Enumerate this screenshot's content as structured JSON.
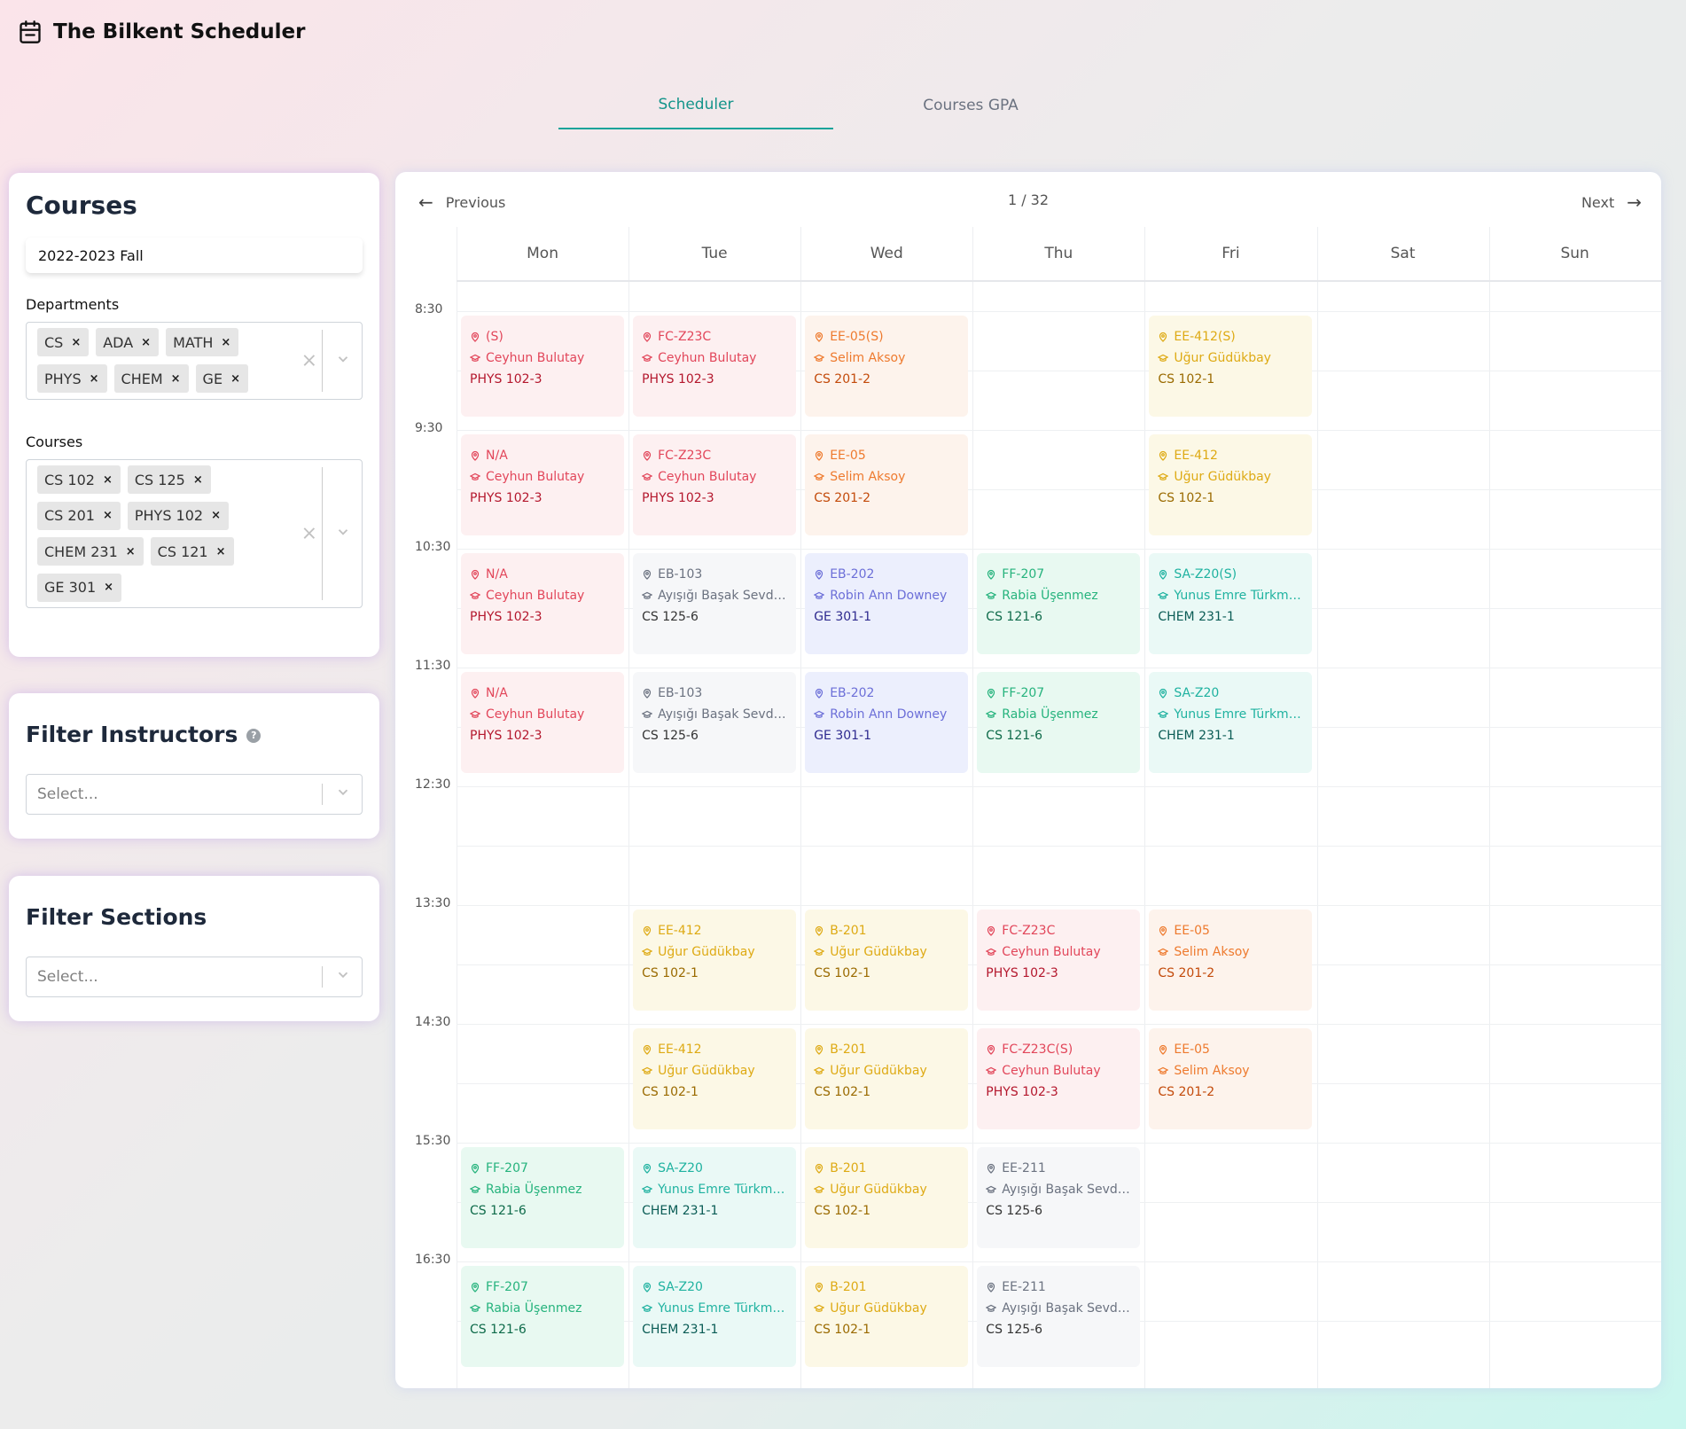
{
  "app": {
    "title": "The Bilkent Scheduler",
    "logo_icon": "calendar-icon"
  },
  "tabs": [
    {
      "label": "Scheduler",
      "active": true
    },
    {
      "label": "Courses GPA",
      "active": false
    }
  ],
  "sidebar": {
    "courses_card": {
      "title": "Courses",
      "semester": "2022-2023 Fall",
      "departments_label": "Departments",
      "departments": [
        "CS",
        "ADA",
        "MATH",
        "PHYS",
        "CHEM",
        "GE"
      ],
      "courses_label": "Courses",
      "courses": [
        "CS 102",
        "CS 125",
        "CS 201",
        "PHYS 102",
        "CHEM 231",
        "CS 121",
        "GE 301"
      ],
      "remove_glyph": "×",
      "clear_glyph": "×"
    },
    "instructors_card": {
      "title": "Filter Instructors",
      "help": "?",
      "placeholder": "Select..."
    },
    "sections_card": {
      "title": "Filter Sections",
      "placeholder": "Select..."
    }
  },
  "calendar": {
    "prev_label": "Previous",
    "next_label": "Next",
    "page": "1 / 32",
    "days": [
      "Mon",
      "Tue",
      "Wed",
      "Thu",
      "Fri",
      "Sat",
      "Sun"
    ],
    "times": [
      "8:30",
      "9:30",
      "10:30",
      "11:30",
      "12:30",
      "13:30",
      "14:30",
      "15:30",
      "16:30"
    ],
    "colors": {
      "red": "#e2465a",
      "orange": "#ee7a2e",
      "yellow": "#deaa14",
      "gray": "#6b7280",
      "indigo": "#6c6fd8",
      "green": "#26b37d",
      "teal": "#1fb2a0"
    },
    "events": [
      {
        "day": 0,
        "slot": 0,
        "color": "red",
        "room": "(S)",
        "instructor": "Ceyhun Bulutay",
        "course": "PHYS 102-3"
      },
      {
        "day": 0,
        "slot": 1,
        "color": "red",
        "room": "N/A",
        "instructor": "Ceyhun Bulutay",
        "course": "PHYS 102-3"
      },
      {
        "day": 0,
        "slot": 2,
        "color": "red",
        "room": "N/A",
        "instructor": "Ceyhun Bulutay",
        "course": "PHYS 102-3"
      },
      {
        "day": 0,
        "slot": 3,
        "color": "red",
        "room": "N/A",
        "instructor": "Ceyhun Bulutay",
        "course": "PHYS 102-3"
      },
      {
        "day": 0,
        "slot": 7,
        "color": "green",
        "room": "FF-207",
        "instructor": "Rabia Üşenmez",
        "course": "CS 121-6"
      },
      {
        "day": 0,
        "slot": 8,
        "color": "green",
        "room": "FF-207",
        "instructor": "Rabia Üşenmez",
        "course": "CS 121-6"
      },
      {
        "day": 1,
        "slot": 0,
        "color": "red",
        "room": "FC-Z23C",
        "instructor": "Ceyhun Bulutay",
        "course": "PHYS 102-3"
      },
      {
        "day": 1,
        "slot": 1,
        "color": "red",
        "room": "FC-Z23C",
        "instructor": "Ceyhun Bulutay",
        "course": "PHYS 102-3"
      },
      {
        "day": 1,
        "slot": 2,
        "color": "gray",
        "room": "EB-103",
        "instructor": "Ayışığı Başak Sevdik Ç...",
        "course": "CS 125-6"
      },
      {
        "day": 1,
        "slot": 3,
        "color": "gray",
        "room": "EB-103",
        "instructor": "Ayışığı Başak Sevdik Ç...",
        "course": "CS 125-6"
      },
      {
        "day": 1,
        "slot": 5,
        "color": "yellow",
        "room": "EE-412",
        "instructor": "Uğur Güdükbay",
        "course": "CS 102-1"
      },
      {
        "day": 1,
        "slot": 6,
        "color": "yellow",
        "room": "EE-412",
        "instructor": "Uğur Güdükbay",
        "course": "CS 102-1"
      },
      {
        "day": 1,
        "slot": 7,
        "color": "teal",
        "room": "SA-Z20",
        "instructor": "Yunus Emre Türkmen",
        "course": "CHEM 231-1"
      },
      {
        "day": 1,
        "slot": 8,
        "color": "teal",
        "room": "SA-Z20",
        "instructor": "Yunus Emre Türkmen",
        "course": "CHEM 231-1"
      },
      {
        "day": 2,
        "slot": 0,
        "color": "orange",
        "room": "EE-05(S)",
        "instructor": "Selim Aksoy",
        "course": "CS 201-2"
      },
      {
        "day": 2,
        "slot": 1,
        "color": "orange",
        "room": "EE-05",
        "instructor": "Selim Aksoy",
        "course": "CS 201-2"
      },
      {
        "day": 2,
        "slot": 2,
        "color": "indigo",
        "room": "EB-202",
        "instructor": "Robin Ann Downey",
        "course": "GE 301-1"
      },
      {
        "day": 2,
        "slot": 3,
        "color": "indigo",
        "room": "EB-202",
        "instructor": "Robin Ann Downey",
        "course": "GE 301-1"
      },
      {
        "day": 2,
        "slot": 5,
        "color": "yellow",
        "room": "B-201",
        "instructor": "Uğur Güdükbay",
        "course": "CS 102-1"
      },
      {
        "day": 2,
        "slot": 6,
        "color": "yellow",
        "room": "B-201",
        "instructor": "Uğur Güdükbay",
        "course": "CS 102-1"
      },
      {
        "day": 2,
        "slot": 7,
        "color": "yellow",
        "room": "B-201",
        "instructor": "Uğur Güdükbay",
        "course": "CS 102-1"
      },
      {
        "day": 2,
        "slot": 8,
        "color": "yellow",
        "room": "B-201",
        "instructor": "Uğur Güdükbay",
        "course": "CS 102-1"
      },
      {
        "day": 3,
        "slot": 2,
        "color": "green",
        "room": "FF-207",
        "instructor": "Rabia Üşenmez",
        "course": "CS 121-6"
      },
      {
        "day": 3,
        "slot": 3,
        "color": "green",
        "room": "FF-207",
        "instructor": "Rabia Üşenmez",
        "course": "CS 121-6"
      },
      {
        "day": 3,
        "slot": 5,
        "color": "red",
        "room": "FC-Z23C",
        "instructor": "Ceyhun Bulutay",
        "course": "PHYS 102-3"
      },
      {
        "day": 3,
        "slot": 6,
        "color": "red",
        "room": "FC-Z23C(S)",
        "instructor": "Ceyhun Bulutay",
        "course": "PHYS 102-3"
      },
      {
        "day": 3,
        "slot": 7,
        "color": "gray",
        "room": "EE-211",
        "instructor": "Ayışığı Başak Sevdik Ç...",
        "course": "CS 125-6"
      },
      {
        "day": 3,
        "slot": 8,
        "color": "gray",
        "room": "EE-211",
        "instructor": "Ayışığı Başak Sevdik Ç...",
        "course": "CS 125-6"
      },
      {
        "day": 4,
        "slot": 0,
        "color": "yellow",
        "room": "EE-412(S)",
        "instructor": "Uğur Güdükbay",
        "course": "CS 102-1"
      },
      {
        "day": 4,
        "slot": 1,
        "color": "yellow",
        "room": "EE-412",
        "instructor": "Uğur Güdükbay",
        "course": "CS 102-1"
      },
      {
        "day": 4,
        "slot": 2,
        "color": "teal",
        "room": "SA-Z20(S)",
        "instructor": "Yunus Emre Türkmen",
        "course": "CHEM 231-1"
      },
      {
        "day": 4,
        "slot": 3,
        "color": "teal",
        "room": "SA-Z20",
        "instructor": "Yunus Emre Türkmen",
        "course": "CHEM 231-1"
      },
      {
        "day": 4,
        "slot": 5,
        "color": "orange",
        "room": "EE-05",
        "instructor": "Selim Aksoy",
        "course": "CS 201-2"
      },
      {
        "day": 4,
        "slot": 6,
        "color": "orange",
        "room": "EE-05",
        "instructor": "Selim Aksoy",
        "course": "CS 201-2"
      }
    ]
  }
}
